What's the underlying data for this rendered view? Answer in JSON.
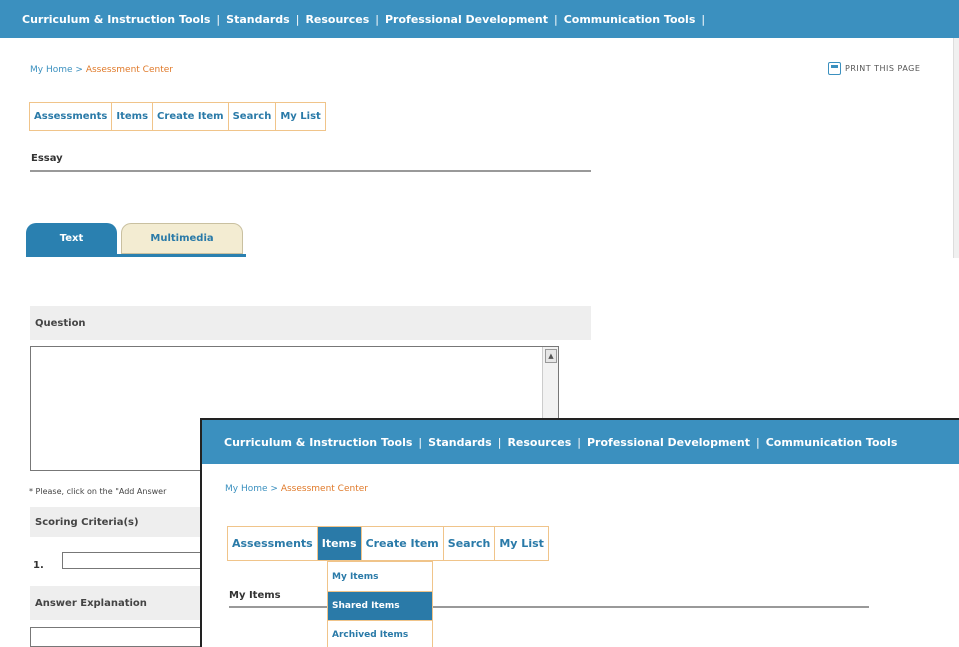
{
  "nav": {
    "items": [
      "Curriculum & Instruction Tools",
      "Standards",
      "Resources",
      "Professional Development",
      "Communication Tools"
    ],
    "trailing_sep": "|"
  },
  "breadcrumb": {
    "home": "My Home",
    "separator": ">",
    "current": "Assessment Center"
  },
  "print_label": "PRINT THIS PAGE",
  "subnav": [
    "Assessments",
    "Items",
    "Create Item",
    "Search",
    "My List"
  ],
  "essay_title": "Essay",
  "tabs": {
    "text": "Text",
    "multimedia": "Multimedia"
  },
  "question_label": "Question",
  "note": "* Please, click on the \"Add Answer",
  "scoring_label": "Scoring Criteria(s)",
  "scoring_item_number": "1.",
  "answer_explanation_label": "Answer Explanation",
  "overlay": {
    "nav": [
      "Curriculum & Instruction Tools",
      "Standards",
      "Resources",
      "Professional Development",
      "Communication Tools"
    ],
    "breadcrumb": {
      "home": "My Home",
      "separator": ">",
      "current": "Assessment Center"
    },
    "subnav": [
      "Assessments",
      "Items",
      "Create Item",
      "Search",
      "My List"
    ],
    "active_subnav": "Items",
    "dropdown": [
      "My Items",
      "Shared Items",
      "Archived Items"
    ],
    "active_dropdown": "Shared Items",
    "my_items_title": "My Items"
  },
  "colors": {
    "nav_bg": "#3b90bf",
    "accent": "#2a7aa8",
    "border_orange": "#f0c48a",
    "breadcrumb_current": "#e07a2a"
  }
}
